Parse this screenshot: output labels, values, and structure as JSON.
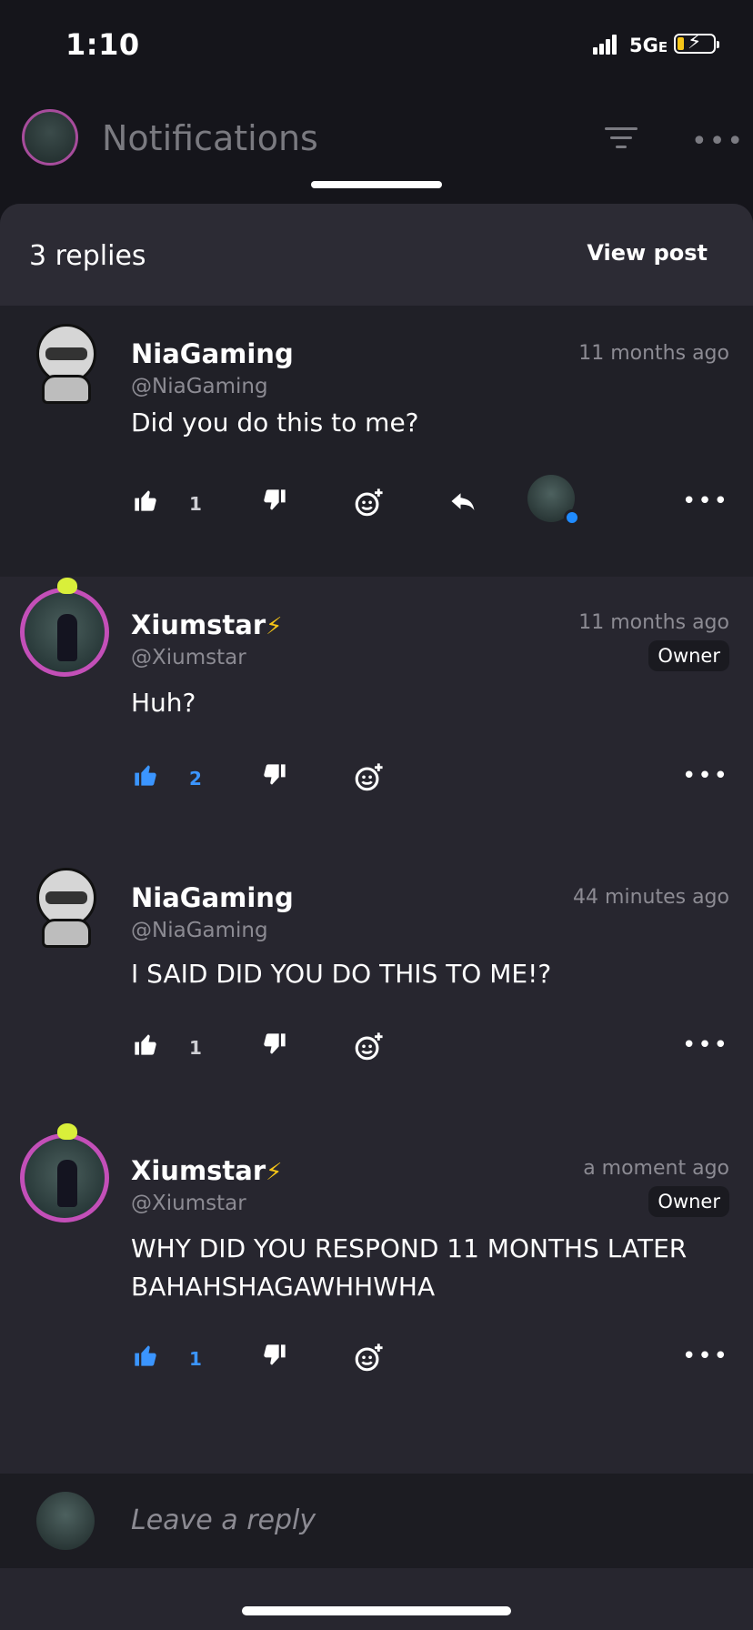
{
  "status_bar": {
    "time": "1:10",
    "network": "5G",
    "network_sub": "E"
  },
  "header": {
    "title": "Notifications"
  },
  "sheet": {
    "replies_label": "3 replies",
    "view_post_label": "View post"
  },
  "comments": [
    {
      "name": "NiaGaming",
      "handle": "@NiaGaming",
      "time": "11 months ago",
      "text": "Did you do this to me?",
      "likes": "1",
      "owner": ""
    },
    {
      "name": "Xiumstar",
      "handle": "@Xiumstar",
      "time": "11 months ago",
      "text": "Huh?",
      "likes": "2",
      "owner": "Owner"
    },
    {
      "name": "NiaGaming",
      "handle": "@NiaGaming",
      "time": "44 minutes ago",
      "text": "I SAID DID YOU DO THIS TO ME!?",
      "likes": "1",
      "owner": ""
    },
    {
      "name": "Xiumstar",
      "handle": "@Xiumstar",
      "time": "a moment ago",
      "text": "WHY DID YOU RESPOND 11 MONTHS LATER BAHAHSHAGAWHHWHA",
      "likes": "1",
      "owner": "Owner"
    }
  ],
  "reply_bar": {
    "placeholder": "Leave a reply"
  },
  "colors": {
    "accent_blue": "#3b95ff",
    "owner_badge_bg": "#1a1a20",
    "avatar_ring": "#c34fb8",
    "bolt": "#f6c518"
  }
}
